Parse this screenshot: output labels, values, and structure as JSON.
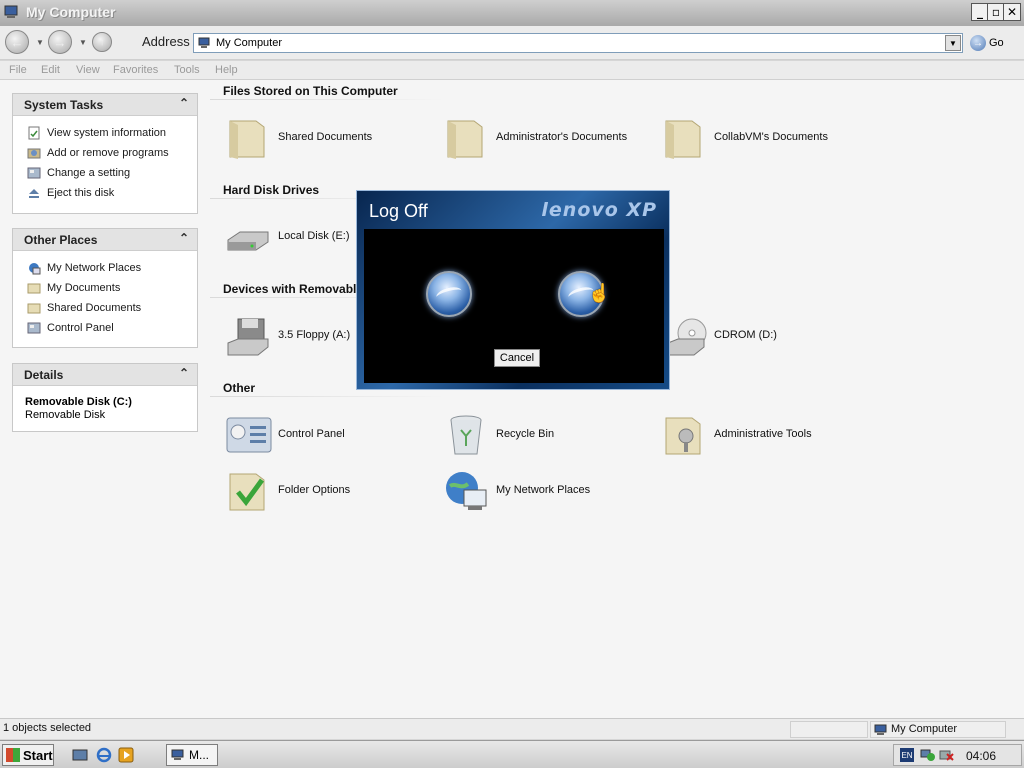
{
  "window": {
    "title": "My Computer",
    "controls": [
      "_",
      "▫",
      "✕"
    ]
  },
  "toolbar": {
    "address_label": "Address",
    "address_value": "My Computer",
    "go_label": "Go"
  },
  "menu": [
    "File",
    "Edit",
    "View",
    "Favorites",
    "Tools",
    "Help"
  ],
  "sidebar": {
    "system_tasks": {
      "title": "System Tasks",
      "items": [
        {
          "label": "View system information",
          "icon": "system-info-icon"
        },
        {
          "label": "Add or remove programs",
          "icon": "add-remove-icon"
        },
        {
          "label": "Change a setting",
          "icon": "control-panel-icon"
        },
        {
          "label": "Eject this disk",
          "icon": "eject-icon"
        }
      ]
    },
    "other_places": {
      "title": "Other Places",
      "items": [
        {
          "label": "My Network Places",
          "icon": "network-icon"
        },
        {
          "label": "My Documents",
          "icon": "folder-icon"
        },
        {
          "label": "Shared Documents",
          "icon": "folder-icon"
        },
        {
          "label": "Control Panel",
          "icon": "control-panel-icon"
        }
      ]
    },
    "details": {
      "title": "Details",
      "name": "Removable Disk (C:)",
      "type": "Removable Disk"
    }
  },
  "main": {
    "sections": {
      "files": "Files Stored on This Computer",
      "hdd": "Hard Disk Drives",
      "removable": "Devices with Removable",
      "other": "Other"
    },
    "files": [
      "Shared Documents",
      "Administrator's Documents",
      "CollabVM's Documents"
    ],
    "hdd": [
      "Local Disk (E:)"
    ],
    "removable": [
      "3.5 Floppy (A:)",
      "CDROM (D:)"
    ],
    "other": [
      "Control Panel",
      "Recycle Bin",
      "Administrative Tools",
      "Folder Options",
      "My Network Places"
    ]
  },
  "dialog": {
    "title": "Log Off",
    "logo": "lenovo XP",
    "cancel_label": "Cancel"
  },
  "statusbar": {
    "selection": "1 objects selected",
    "location": "My Computer"
  },
  "taskbar": {
    "start_label": "Start",
    "task_label": "M...",
    "lang": "EN",
    "clock": "04:06"
  },
  "colors": {
    "dialog_bg": "#0a2f5e",
    "accent": "#4f79b5"
  }
}
